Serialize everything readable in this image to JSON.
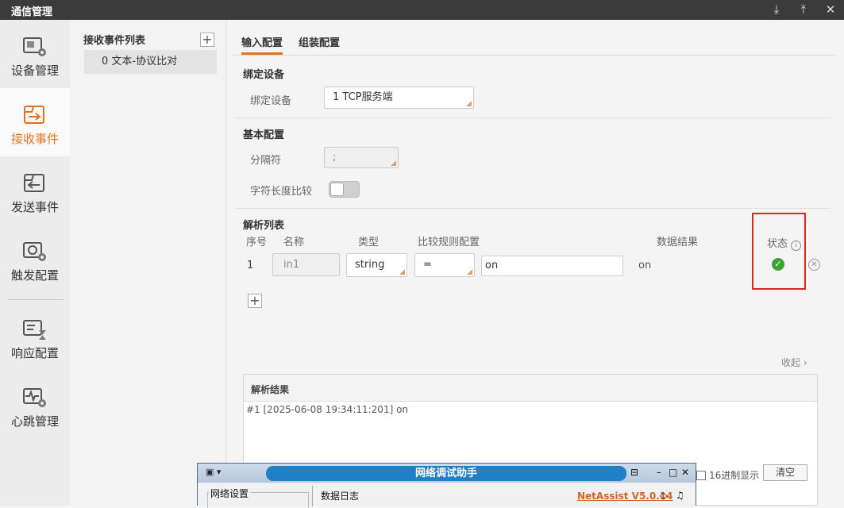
{
  "window": {
    "title": "通信管理"
  },
  "nav": [
    {
      "label": "设备管理",
      "icon": "device-gear-icon"
    },
    {
      "label": "接收事件",
      "icon": "receive-event-icon",
      "active": true
    },
    {
      "label": "发送事件",
      "icon": "send-event-icon"
    },
    {
      "label": "触发配置",
      "icon": "trigger-config-icon"
    },
    {
      "label": "响应配置",
      "icon": "response-config-icon"
    },
    {
      "label": "心跳管理",
      "icon": "heartbeat-icon"
    }
  ],
  "events": {
    "header": "接收事件列表",
    "items": [
      "0 文本-协议比对"
    ]
  },
  "tabs": [
    "输入配置",
    "组装配置"
  ],
  "bind_device": {
    "section": "绑定设备",
    "label": "绑定设备",
    "value": "1 TCP服务端"
  },
  "basic": {
    "section": "基本配置",
    "separator_label": "分隔符",
    "separator_value": ";",
    "strlen_label": "字符长度比较",
    "strlen_enabled": false
  },
  "parse": {
    "section": "解析列表",
    "columns": [
      "序号",
      "名称",
      "类型",
      "比较规则配置",
      "数据结果",
      "状态"
    ],
    "rows": [
      {
        "index": "1",
        "name": "in1",
        "type": "string",
        "rule": "=",
        "rule_value": "on",
        "result": "on",
        "status": "ok"
      }
    ]
  },
  "collapse_label": "收起",
  "result_panel": {
    "title": "解析结果",
    "lines": [
      "#1 [2025-06-08  19:34:11:201] on"
    ]
  },
  "hex_label": "16进制显示",
  "clear_label": "清空",
  "netassist": {
    "title": "网络调试助手",
    "network_settings": "网络设置",
    "data_log": "数据日志",
    "version": "NetAssist V5.0.14"
  },
  "colors": {
    "accent": "#e8701a",
    "highlight_box": "#e02424",
    "ok": "#3aa535"
  }
}
